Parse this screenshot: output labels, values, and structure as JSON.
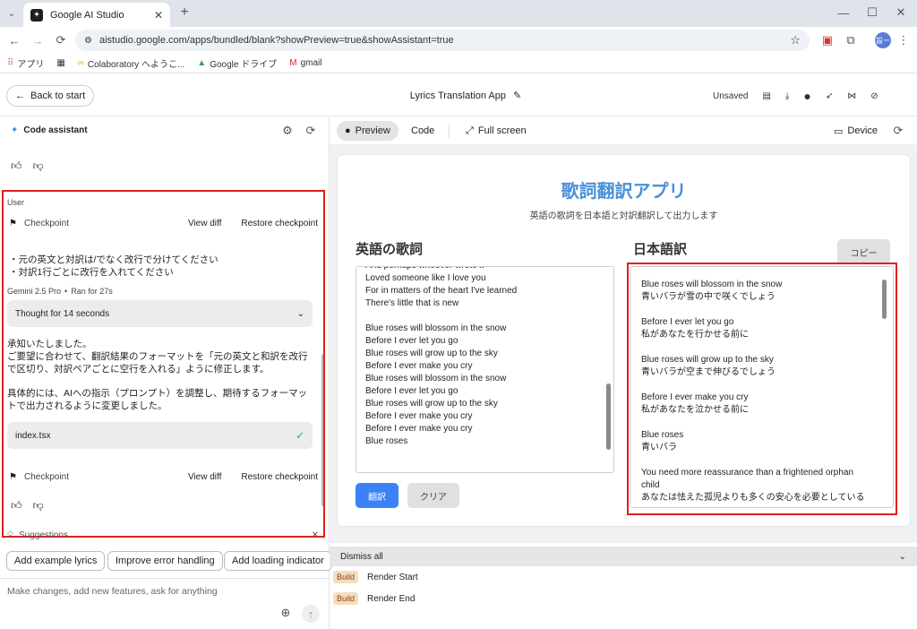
{
  "browser": {
    "tab_title": "Google AI Studio",
    "url": "aistudio.google.com/apps/bundled/blank?showPreview=true&showAssistant=true",
    "bookmarks": [
      "アプリ",
      "Colaboratory へようこ...",
      "Google ドライブ",
      "gmail"
    ],
    "profile_label": "設ー"
  },
  "header": {
    "back_label": "Back to start",
    "app_title": "Lyrics Translation App",
    "unsaved_label": "Unsaved"
  },
  "assistant": {
    "title": "Code assistant",
    "user_label": "User",
    "checkpoint_label": "Checkpoint",
    "view_diff_label": "View diff",
    "restore_label": "Restore checkpoint",
    "user_message": [
      "・元の英文と対訳は/でなく改行で分けてください",
      "・対訳1行ごとに改行を入れてください"
    ],
    "model_label": "Gemini 2.5 Pro",
    "ran_label": "Ran for 27s",
    "thought_label": "Thought for 14 seconds",
    "reply_1": "承知いたしました。\nご要望に合わせて、翻訳結果のフォーマットを「元の英文と和訳を改行で区切り、対訳ペアごとに空行を入れる」ように修正します。",
    "reply_2": "具体的には、AIへの指示（プロンプト）を調整し、期待するフォーマットで出力されるように変更しました。",
    "file_label": "index.tsx",
    "suggestions_label": "Suggestions",
    "suggestions": [
      "Add example lyrics",
      "Improve error handling",
      "Add loading indicator"
    ],
    "composer_placeholder": "Make changes, add new features, ask for anything"
  },
  "preview": {
    "tabs": {
      "preview": "Preview",
      "code": "Code",
      "fullscreen": "Full screen",
      "device": "Device"
    },
    "app_heading": "歌詞翻訳アプリ",
    "app_subtitle": "英語の歌詞を日本語と対訳翻訳して出力します",
    "left_heading": "英語の歌詞",
    "right_heading": "日本語訳",
    "copy_label": "コピー",
    "translate_label": "翻訳",
    "clear_label": "クリア",
    "english_lines": [
      "And perhaps whoever wrote it",
      "Loved someone like I love you",
      "For in matters of the heart I've learned",
      "There's little that is new",
      "",
      "Blue roses will blossom in the snow",
      "Before I ever let you go",
      "Blue roses will grow up to the sky",
      "Before I ever make you cry",
      "Blue roses will blossom in the snow",
      "Before I ever let you go",
      "Blue roses will grow up to the sky",
      "Before I ever make you cry",
      "Before I ever make you cry",
      "Blue roses"
    ],
    "japanese_lines": [
      "Blue roses will blossom in the snow",
      "青いバラが雪の中で咲くでしょう",
      "",
      "Before I ever let you go",
      "私があなたを行かせる前に",
      "",
      "Blue roses will grow up to the sky",
      "青いバラが空まで伸びるでしょう",
      "",
      "Before I ever make you cry",
      "私があなたを泣かせる前に",
      "",
      "Blue roses",
      "青いバラ",
      "",
      "You need more reassurance than a frightened orphan",
      "child",
      "あなたは怯えた孤児よりも多くの安心を必要としている"
    ]
  },
  "console": {
    "dismiss_label": "Dismiss all",
    "logs": [
      {
        "badge": "Build",
        "text": "Render Start"
      },
      {
        "badge": "Build",
        "text": "Render End"
      }
    ]
  },
  "colors": {
    "accent_blue": "#3b82f6",
    "heading_blue": "#4a90d9",
    "highlight_red": "#e0201d"
  }
}
